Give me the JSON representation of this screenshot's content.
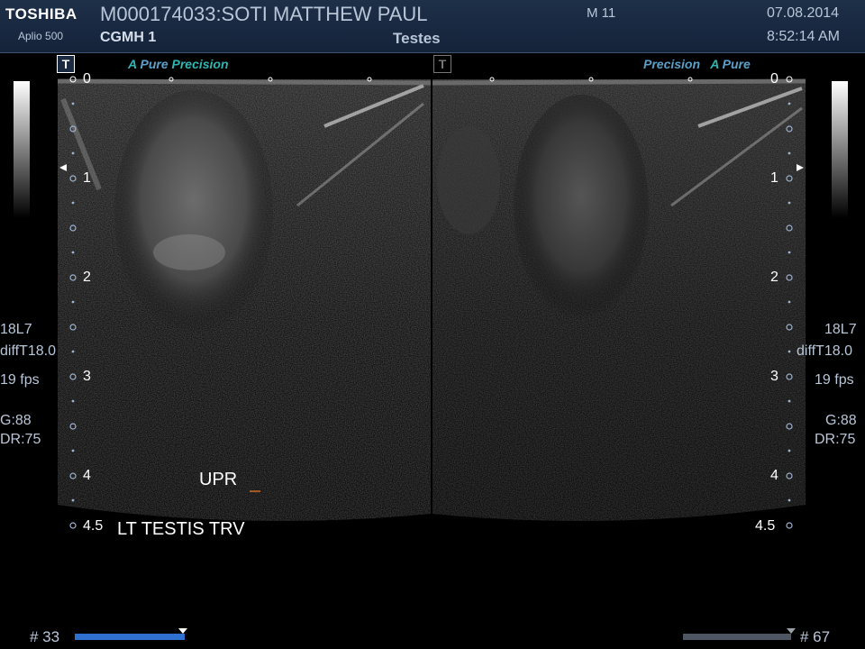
{
  "header": {
    "brand": "TOSHIBA",
    "model": "Aplio 500",
    "patient": "M000174033:SOTI MATTHEW PAUL",
    "institution": "CGMH 1",
    "mode": "M 11",
    "study": "Testes",
    "date": "07.08.2014",
    "time": "8:52:14 AM"
  },
  "panes": {
    "left": {
      "tag": "T",
      "labels": {
        "a1": "A",
        "pure": "Pure",
        "precision": "Precision"
      },
      "probe": "18L7",
      "filter": "diffT18.0",
      "fps": "19 fps",
      "gain": "G:88",
      "dr": "DR:75",
      "frame": "# 33",
      "cine_position": 1.0
    },
    "right": {
      "tag": "T",
      "labels": {
        "precision": "Precision",
        "a1": "A",
        "pure": "Pure"
      },
      "probe": "18L7",
      "filter": "diffT18.0",
      "fps": "19 fps",
      "gain": "G:88",
      "dr": "DR:75",
      "frame": "# 67",
      "cine_position": 1.0
    }
  },
  "depth_scale": {
    "labels": [
      "0",
      "1",
      "2",
      "3",
      "4",
      "4.5"
    ],
    "values_cm": [
      0,
      1,
      2,
      3,
      4,
      4.5
    ]
  },
  "annotations": {
    "orientation": "UPR",
    "caption": "LT TESTIS TRV"
  },
  "colors": {
    "header_bg": "#1a2a42",
    "header_text": "#b8c6d8",
    "cine_bar_active": "#2f6fd0",
    "cine_bar_inactive": "#4e5563",
    "apure_accent": "#2fb6b2",
    "precision": "#5aa0c8",
    "cursor_marker": "#d06a20"
  }
}
